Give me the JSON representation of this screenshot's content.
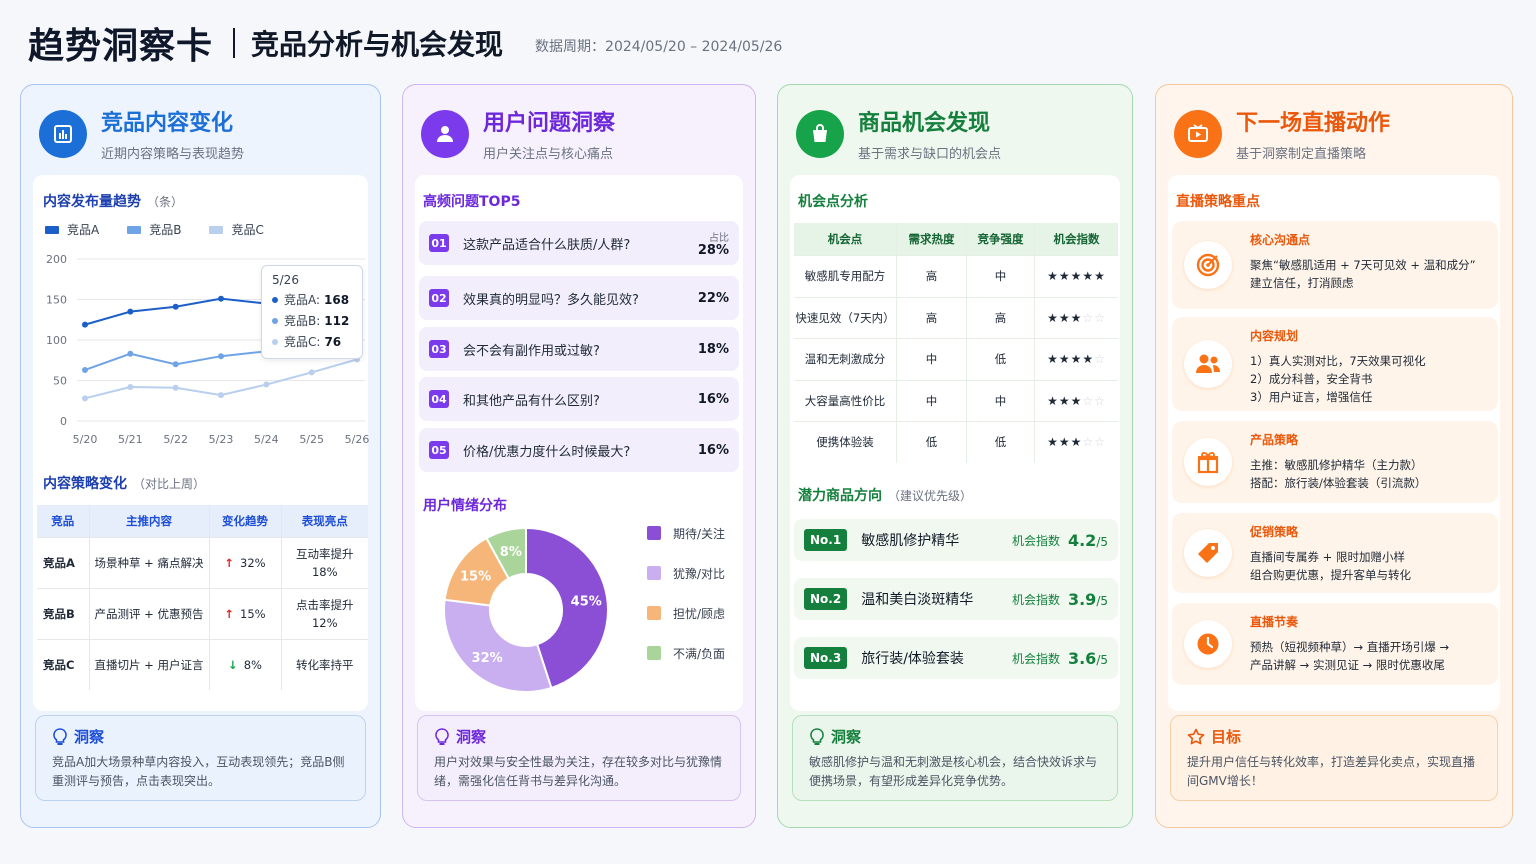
{
  "header": {
    "title": "趋势洞察卡",
    "subtitle": "竞品分析与机会发现",
    "period": "数据周期：2024/05/20 – 2024/05/26"
  },
  "colors": {
    "blue": "#1d6fd8",
    "purple": "#7c3aed",
    "green": "#16a34a",
    "orange": "#f97316"
  },
  "card1": {
    "title": "竞品内容变化",
    "subtitle": "近期内容策略与表现趋势",
    "chart_title": "内容发布量趋势",
    "chart_unit": "（条）",
    "legend": [
      "竞品A",
      "竞品B",
      "竞品C"
    ],
    "tooltip": {
      "date": "5/26",
      "a_label": "竞品A:",
      "a": "168",
      "b_label": "竞品B:",
      "b": "112",
      "c_label": "竞品C:",
      "c": "76"
    },
    "strategy_title": "内容策略变化",
    "strategy_note": "（对比上周）",
    "table_headers": [
      "竞品",
      "主推内容",
      "变化趋势",
      "表现亮点"
    ],
    "rows": [
      {
        "name": "竞品A",
        "content": "场景种草 + 痛点解决",
        "arrow": "↑",
        "trend": "32%",
        "highlight": "互动率提升\n18%"
      },
      {
        "name": "竞品B",
        "content": "产品测评 + 优惠预告",
        "arrow": "↑",
        "trend": "15%",
        "highlight": "点击率提升\n12%"
      },
      {
        "name": "竞品C",
        "content": "直播切片 + 用户证言",
        "arrow": "↓",
        "trend": "8%",
        "highlight": "转化率持平"
      }
    ],
    "insight_title": "洞察",
    "insight_text": "竞品A加大场景种草内容投入，互动表现领先；竞品B侧重测评与预告，点击表现突出。"
  },
  "chart_data": [
    {
      "type": "line",
      "title": "内容发布量趋势（条）",
      "x": [
        "5/20",
        "5/21",
        "5/22",
        "5/23",
        "5/24",
        "5/25",
        "5/26"
      ],
      "series": [
        {
          "name": "竞品A",
          "values": [
            119,
            135,
            141,
            151,
            145,
            166,
            168
          ]
        },
        {
          "name": "竞品B",
          "values": [
            63,
            83,
            70,
            80,
            86,
            107,
            112
          ]
        },
        {
          "name": "竞品C",
          "values": [
            28,
            42,
            41,
            32,
            45,
            60,
            76
          ]
        }
      ],
      "ylim": [
        0,
        200
      ],
      "yticks": [
        0,
        50,
        100,
        150,
        200
      ],
      "grid": true,
      "legend": "top-left"
    },
    {
      "type": "pie",
      "title": "用户情绪分布",
      "categories": [
        "期待/关注",
        "犹豫/对比",
        "担忧/顾虑",
        "不满/负面"
      ],
      "values": [
        45,
        32,
        15,
        8
      ],
      "colors": [
        "#8b4fd6",
        "#c9aef0",
        "#f6b67a",
        "#a9d59a"
      ],
      "labels": [
        "45%",
        "32%",
        "15%",
        "8%"
      ],
      "legend": "right"
    }
  ],
  "card2": {
    "title": "用户问题洞察",
    "subtitle": "用户关注点与核心痛点",
    "top_title": "高频问题TOP5",
    "ratio_label": "占比",
    "questions": [
      {
        "no": "01",
        "text": "这款产品适合什么肤质/人群?",
        "pct": "28%"
      },
      {
        "no": "02",
        "text": "效果真的明显吗？多久能见效?",
        "pct": "22%"
      },
      {
        "no": "03",
        "text": "会不会有副作用或过敏?",
        "pct": "18%"
      },
      {
        "no": "04",
        "text": "和其他产品有什么区别?",
        "pct": "16%"
      },
      {
        "no": "05",
        "text": "价格/优惠力度什么时候最大?",
        "pct": "16%"
      }
    ],
    "emotion_title": "用户情绪分布",
    "insight_title": "洞察",
    "insight_text": "用户对效果与安全性最为关注，存在较多对比与犹豫情绪，需强化信任背书与差异化沟通。"
  },
  "card3": {
    "title": "商品机会发现",
    "subtitle": "基于需求与缺口的机会点",
    "opp_title": "机会点分析",
    "table_headers": [
      "机会点",
      "需求热度",
      "竞争强度",
      "机会指数"
    ],
    "rows": [
      {
        "name": "敏感肌专用配方",
        "demand": "高",
        "competition": "中",
        "stars": "★★★★★",
        "empty": ""
      },
      {
        "name": "快速见效（7天内）",
        "demand": "高",
        "competition": "高",
        "stars": "★★★",
        "empty": "☆☆"
      },
      {
        "name": "温和无刺激成分",
        "demand": "中",
        "competition": "低",
        "stars": "★★★★",
        "empty": "☆"
      },
      {
        "name": "大容量高性价比",
        "demand": "中",
        "competition": "中",
        "stars": "★★★",
        "empty": "☆☆"
      },
      {
        "name": "便携体验装",
        "demand": "低",
        "competition": "低",
        "stars": "★★★",
        "empty": "☆☆"
      }
    ],
    "potential_title": "潜力商品方向",
    "potential_note": "（建议优先级）",
    "index_label": "机会指数",
    "products": [
      {
        "no": "No.1",
        "name": "敏感肌修护精华",
        "score": "4.2",
        "max": "/5"
      },
      {
        "no": "No.2",
        "name": "温和美白淡斑精华",
        "score": "3.9",
        "max": "/5"
      },
      {
        "no": "No.3",
        "name": "旅行装/体验套装",
        "score": "3.6",
        "max": "/5"
      }
    ],
    "insight_title": "洞察",
    "insight_text": "敏感肌修护与温和无刺激是核心机会，结合快效诉求与便携场景，有望形成差异化竞争优势。"
  },
  "card4": {
    "title": "下一场直播动作",
    "subtitle": "基于洞察制定直播策略",
    "focus_title": "直播策略重点",
    "items": [
      {
        "icon": "target-icon",
        "title": "核心沟通点",
        "text": "聚焦“敏感肌适用 + 7天可见效 + 温和成分”\n建立信任，打消顾虑"
      },
      {
        "icon": "users-icon",
        "title": "内容规划",
        "text": "1）真人实测对比，7天效果可视化\n2）成分科普，安全背书\n3）用户证言，增强信任"
      },
      {
        "icon": "gift-icon",
        "title": "产品策略",
        "text": "主推：敏感肌修护精华（主力款）\n搭配：旅行装/体验套装（引流款）"
      },
      {
        "icon": "tag-icon",
        "title": "促销策略",
        "text": "直播间专属券 + 限时加赠小样\n组合购更优惠，提升客单与转化"
      },
      {
        "icon": "clock-icon",
        "title": "直播节奏",
        "text": "预热（短视频种草）→ 直播开场引爆 →\n产品讲解 → 实测见证 → 限时优惠收尾"
      }
    ],
    "goal_title": "目标",
    "goal_text": "提升用户信任与转化效率，打造差异化卖点，实现直播间GMV增长！"
  }
}
